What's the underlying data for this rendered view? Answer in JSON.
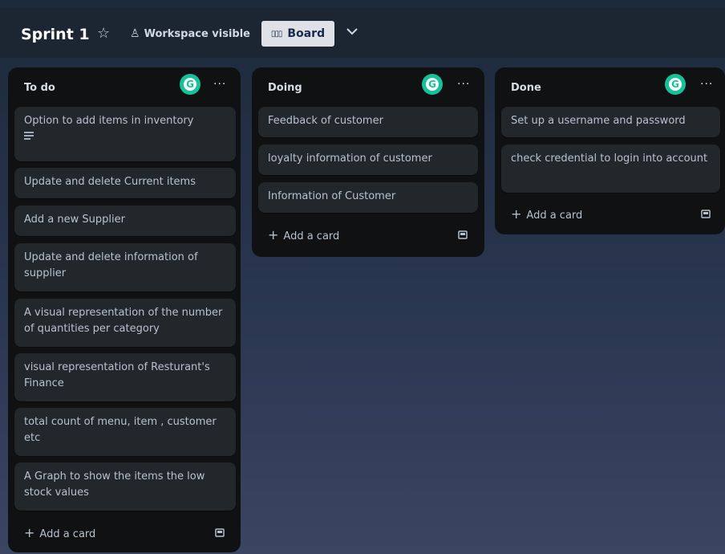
{
  "header": {
    "board_title": "Sprint 1",
    "visibility_label": "Workspace visible",
    "view_label": "Board",
    "icons": {
      "star": "star-icon",
      "visibility": "people-icon",
      "board": "board-icon",
      "chevron": "chevron-down-icon"
    }
  },
  "lists": [
    {
      "title": "To do",
      "cards": [
        {
          "text": "Option to add items in inventory",
          "has_description": true
        },
        {
          "text": "Update and delete Current items"
        },
        {
          "text": "Add a new Supplier"
        },
        {
          "text": "Update and delete information of supplier"
        },
        {
          "text": "A visual representation of the number of quantities per category"
        },
        {
          "text": "visual representation of Resturant's Finance"
        },
        {
          "text": "total count of menu, item , customer etc"
        },
        {
          "text": "A Graph to show the items the low stock values"
        }
      ],
      "add_label": "Add a card"
    },
    {
      "title": "Doing",
      "cards": [
        {
          "text": "Feedback of customer"
        },
        {
          "text": "loyalty information of customer"
        },
        {
          "text": "Information of Customer"
        }
      ],
      "add_label": "Add a card"
    },
    {
      "title": "Done",
      "cards": [
        {
          "text": "Set up a username and password"
        },
        {
          "text": "check credential to login into account"
        }
      ],
      "add_label": "Add a card"
    }
  ],
  "colors": {
    "grammarly": "#15c39a",
    "card": "#22272b",
    "list": "#0f1112",
    "header": "#1c2633"
  }
}
